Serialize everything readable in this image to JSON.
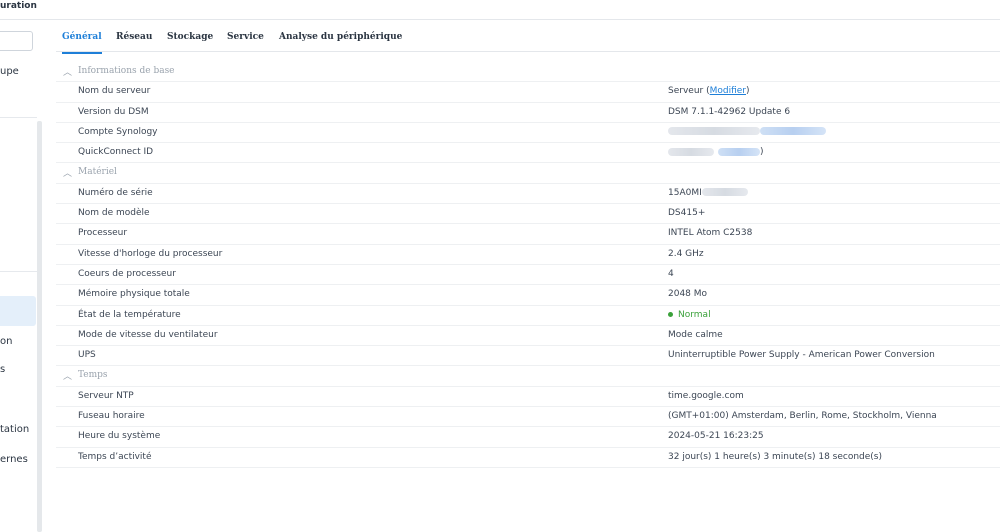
{
  "window": {
    "title": "uration"
  },
  "sidebar": {
    "items": [
      {
        "label": "upe"
      },
      {
        "label": "on"
      },
      {
        "label": "s"
      },
      {
        "label": "tation"
      },
      {
        "label": "ernes"
      }
    ]
  },
  "tabs": [
    {
      "label": "Général",
      "active": true
    },
    {
      "label": "Réseau"
    },
    {
      "label": "Stockage"
    },
    {
      "label": "Service"
    },
    {
      "label": "Analyse du périphérique"
    }
  ],
  "sections": {
    "basic": {
      "title": "Informations de base",
      "rows": [
        {
          "label": "Nom du serveur",
          "value": "Serveur (",
          "link": "Modifier",
          "suffix": ")"
        },
        {
          "label": "Version du DSM",
          "value": "DSM 7.1.1-42962 Update 6"
        },
        {
          "label": "Compte Synology"
        },
        {
          "label": "QuickConnect ID",
          "suffix": ")"
        }
      ]
    },
    "hardware": {
      "title": "Matériel",
      "rows": [
        {
          "label": "Numéro de série",
          "value": "15A0MI"
        },
        {
          "label": "Nom de modèle",
          "value": "DS415+"
        },
        {
          "label": "Processeur",
          "value": "INTEL Atom C2538"
        },
        {
          "label": "Vitesse d'horloge du processeur",
          "value": "2.4 GHz"
        },
        {
          "label": "Coeurs de processeur",
          "value": "4"
        },
        {
          "label": "Mémoire physique totale",
          "value": "2048 Mo"
        },
        {
          "label": "État de la température",
          "value": "Normal",
          "status_color": "#3aa13a"
        },
        {
          "label": "Mode de vitesse du ventilateur",
          "value": "Mode calme"
        },
        {
          "label": "UPS",
          "value": "Uninterruptible Power Supply - American Power Conversion"
        }
      ]
    },
    "time": {
      "title": "Temps",
      "rows": [
        {
          "label": "Serveur NTP",
          "value": "time.google.com"
        },
        {
          "label": "Fuseau horaire",
          "value": "(GMT+01:00) Amsterdam, Berlin, Rome, Stockholm, Vienna"
        },
        {
          "label": "Heure du système",
          "value": "2024-05-21 16:23:25"
        },
        {
          "label": "Temps d’activité",
          "value": "32 jour(s) 1 heure(s) 3 minute(s) 18 seconde(s)"
        }
      ]
    }
  },
  "colors": {
    "accent": "#1e7fd8",
    "status_ok": "#3aa13a",
    "section_label": "#9aa3ad"
  },
  "icons": {
    "section_toggle": "chevron-up-icon"
  }
}
